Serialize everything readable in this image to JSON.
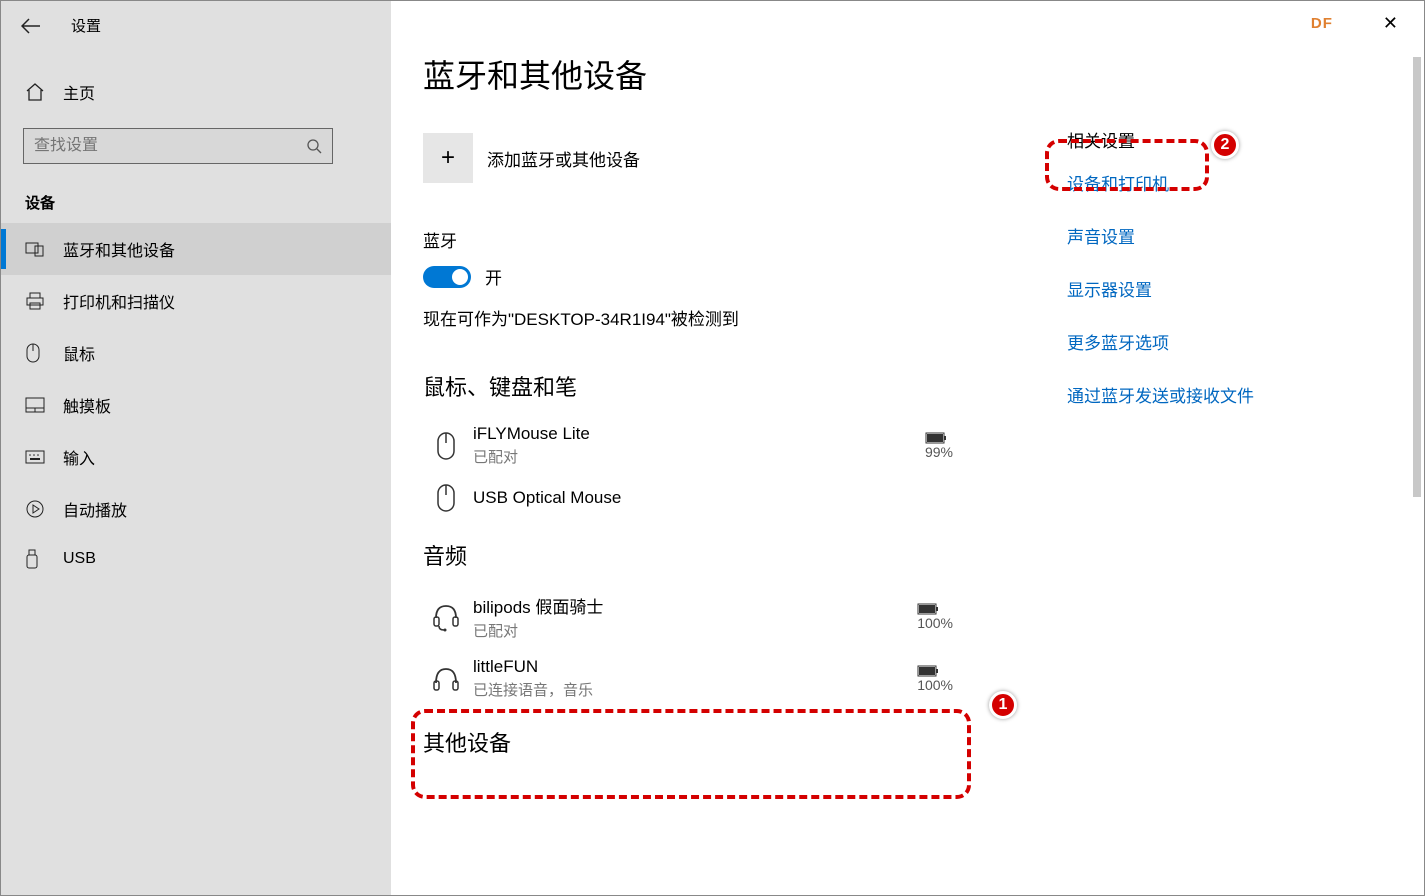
{
  "window_title": "设置",
  "account_badge": "DF",
  "sidebar": {
    "home": "主页",
    "search_placeholder": "查找设置",
    "category": "设备",
    "items": [
      {
        "label": "蓝牙和其他设备"
      },
      {
        "label": "打印机和扫描仪"
      },
      {
        "label": "鼠标"
      },
      {
        "label": "触摸板"
      },
      {
        "label": "输入"
      },
      {
        "label": "自动播放"
      },
      {
        "label": "USB"
      }
    ]
  },
  "main": {
    "page_title": "蓝牙和其他设备",
    "add_device": "添加蓝牙或其他设备",
    "bluetooth_label": "蓝牙",
    "toggle_state": "开",
    "discoverable": "现在可作为\"DESKTOP-34R1I94\"被检测到",
    "groups": [
      {
        "title": "鼠标、键盘和笔",
        "devices": [
          {
            "name": "iFLYMouse Lite",
            "status": "已配对",
            "battery": "99%",
            "icon": "mouse"
          },
          {
            "name": "USB Optical Mouse",
            "status": "",
            "battery": "",
            "icon": "mouse"
          }
        ]
      },
      {
        "title": "音频",
        "devices": [
          {
            "name": "bilipods 假面骑士",
            "status": "已配对",
            "battery": "100%",
            "icon": "headset"
          },
          {
            "name": "littleFUN",
            "status": "已连接语音，音乐",
            "battery": "100%",
            "icon": "headphones"
          }
        ]
      },
      {
        "title": "其他设备",
        "devices": []
      }
    ]
  },
  "related": {
    "title": "相关设置",
    "links": [
      "设备和打印机",
      "声音设置",
      "显示器设置",
      "更多蓝牙选项",
      "通过蓝牙发送或接收文件"
    ]
  },
  "annotations": {
    "a1": "1",
    "a2": "2"
  }
}
